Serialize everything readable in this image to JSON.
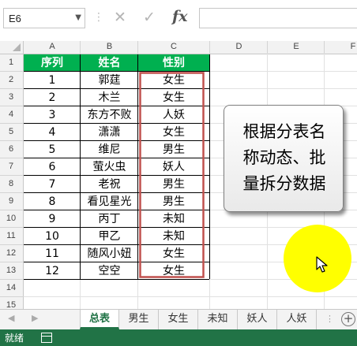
{
  "formula_bar": {
    "name_box": "E6",
    "name_box_dropdown_icon": "chevron-down-icon",
    "cancel_icon": "close-icon",
    "enter_icon": "check-icon",
    "fx_label": "fx",
    "formula_value": ""
  },
  "columns": [
    "A",
    "B",
    "C",
    "D",
    "E",
    "F"
  ],
  "rows": [
    "1",
    "2",
    "3",
    "4",
    "5",
    "6",
    "7",
    "8",
    "9",
    "10",
    "11",
    "12",
    "13",
    "14",
    "15"
  ],
  "table": {
    "headers": [
      "序列",
      "姓名",
      "性别"
    ],
    "header_color": "#00b050",
    "rows": [
      [
        "1",
        "郭莛",
        "女生"
      ],
      [
        "2",
        "木兰",
        "女生"
      ],
      [
        "3",
        "东方不败",
        "人妖"
      ],
      [
        "4",
        "潇潇",
        "女生"
      ],
      [
        "5",
        "维尼",
        "男生"
      ],
      [
        "6",
        "萤火虫",
        "妖人"
      ],
      [
        "7",
        "老祝",
        "男生"
      ],
      [
        "8",
        "看见星光",
        "男生"
      ],
      [
        "9",
        "丙丁",
        "未知"
      ],
      [
        "10",
        "甲乙",
        "未知"
      ],
      [
        "11",
        "随风小妞",
        "女生"
      ],
      [
        "12",
        "空空",
        "女生"
      ]
    ],
    "selection_border_color": "#c0504d"
  },
  "shape_button": {
    "lines": [
      "根据分表名",
      "称动态、批",
      "量拆分数据"
    ]
  },
  "yellow_circle_color": "#ffff00",
  "sheet_tabs": [
    "总表",
    "男生",
    "女生",
    "未知",
    "妖人",
    "人妖"
  ],
  "active_tab": "总表",
  "status_bar": {
    "text": "就绪",
    "color": "#217346"
  }
}
